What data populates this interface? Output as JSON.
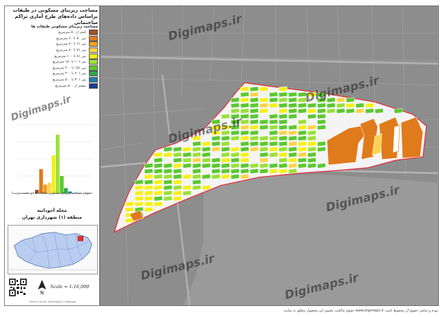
{
  "panel": {
    "title_line1": "مساحت زیربنای مسکونی در طبقات",
    "title_line2": "براساس داده‌های طرح آماری تراکم ساختمانی",
    "legend_header": "مساحت زیربنای مسکونی طبقات ها",
    "legend_items": [
      {
        "label": "کمتر از ۵۰ مترمربع",
        "color": "#a0522d"
      },
      {
        "label": "بین ۵۰ تا ۶۰ مترمربع",
        "color": "#e07b1c"
      },
      {
        "label": "بین ۶۱ تا ۷۰ مترمربع",
        "color": "#f0a020"
      },
      {
        "label": "بین ۷۱ تا ۸۰ مترمربع",
        "color": "#ffd24d"
      },
      {
        "label": "بین ۸۱ تا ۱۰۰ مترمربع",
        "color": "#f5f01a"
      },
      {
        "label": "بین ۱۰۱ تا ۱۵۰ مترمربع",
        "color": "#9be03a"
      },
      {
        "label": "بین ۱۵۱ تا ۲۰۰ مترمربع",
        "color": "#5cc832"
      },
      {
        "label": "بین ۲۰۱ تا ۳۰۰ مترمربع",
        "color": "#2faa4a"
      },
      {
        "label": "بین ۳۰۱ تا ۵۰۰ مترمربع",
        "color": "#1f7fa8"
      },
      {
        "label": "بیشتر از ۵۰۰ مترمربع",
        "color": "#1b3f8f"
      }
    ],
    "chart_caption": "نمودار مساحت زیربنای مسکونی طبقات ها (بر حسب درصد)",
    "district_line1": "محله آجودانیه",
    "district_line2": "منطقه (۱) شهرداری تهران",
    "scale": "Scale = 1:16,000",
    "north": "N",
    "credit": "Source: Tehran Municipality / Digimaps"
  },
  "footer": "حقوق مالکیت معنوی این محصول متعلق به سایت www.digimaps.ir بوده و تمامی حقوق آن محفوظ است.",
  "watermark": "Digimaps.ir",
  "chart_data": {
    "type": "bar",
    "categories": [
      "<50",
      "50-60",
      "61-70",
      "71-80",
      "81-100",
      "101-150",
      "151-200",
      "201-300",
      "301-500",
      ">500"
    ],
    "values": [
      2,
      14,
      5,
      6,
      22,
      34,
      10,
      3,
      1,
      0
    ],
    "colors": [
      "#a0522d",
      "#e07b1c",
      "#f0a020",
      "#ffd24d",
      "#f5f01a",
      "#9be03a",
      "#5cc832",
      "#2faa4a",
      "#1f7fa8",
      "#1b3f8f"
    ],
    "ylim": [
      0,
      40
    ]
  }
}
